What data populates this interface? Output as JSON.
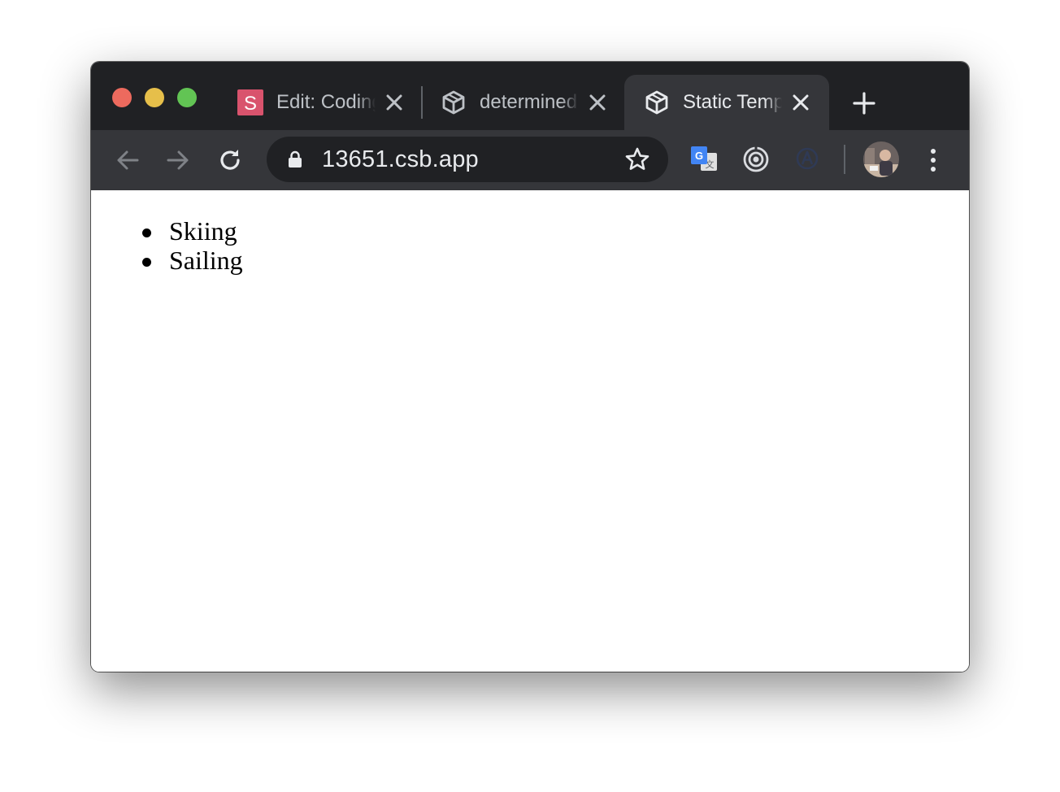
{
  "browser": {
    "tabs": [
      {
        "title": "Edit: Coding",
        "favicon": "sololearn-s-icon",
        "favicon_letter": "S",
        "active": false
      },
      {
        "title": "determined",
        "favicon": "codesandbox-cube-icon",
        "active": false
      },
      {
        "title": "Static Template",
        "favicon": "codesandbox-cube-icon",
        "active": true
      }
    ],
    "url": "13651.csb.app",
    "colors": {
      "titlebar": "#202124",
      "toolbar": "#35363a",
      "omnibox": "#202124",
      "traffic_close": "#ed6a5e",
      "traffic_minimize": "#e6bf4a",
      "traffic_maximize": "#62c454"
    }
  },
  "page": {
    "list_items": [
      "Skiing",
      "Sailing"
    ]
  }
}
